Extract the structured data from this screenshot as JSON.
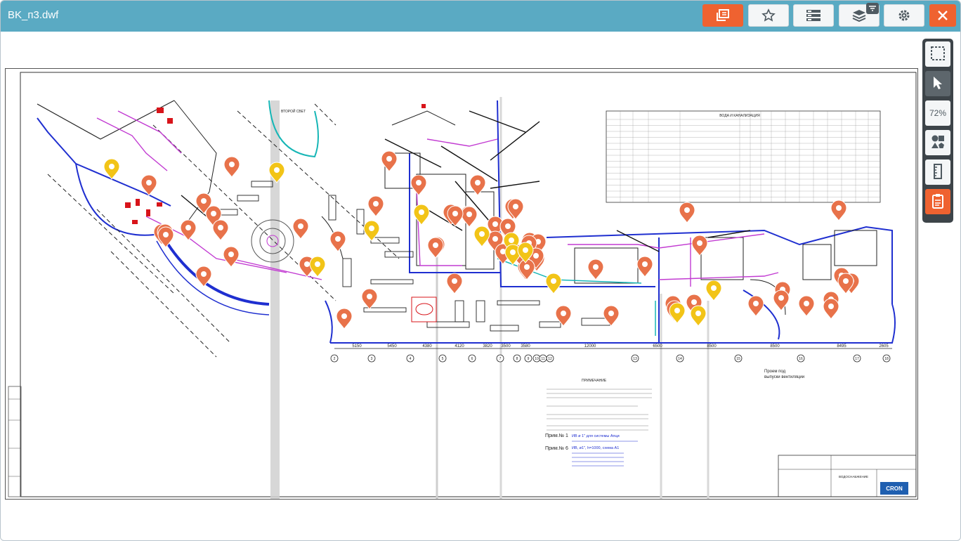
{
  "window": {
    "title": "BK_п3.dwf"
  },
  "toolbar": {
    "buttons": [
      {
        "name": "markup-panel-button",
        "icon": "copy-icon"
      },
      {
        "name": "favorite-button",
        "icon": "star-icon"
      },
      {
        "name": "properties-button",
        "icon": "list-icon"
      },
      {
        "name": "layers-button",
        "icon": "layers-icon"
      },
      {
        "name": "settings-button",
        "icon": "gear-icon"
      },
      {
        "name": "close-button",
        "icon": "close-icon"
      }
    ]
  },
  "side_toolbar": {
    "zoom_label": "72%",
    "tools": [
      "select-area-icon",
      "pointer-icon",
      "zoom",
      "shapes-icon",
      "ruler-icon",
      "clipboard-icon"
    ]
  },
  "drawing": {
    "table_title": "ВОДА И КАНАЛИЗАЦИЯ",
    "notes_title": "ПРИМЕЧАНИЕ",
    "note1_label": "Прим.№ 1",
    "note1_text": "ИВ ø 1\" для системы Апци",
    "note2_label": "Прим.№ 6",
    "note2_text": "ИВ, ø1\", h=1000, схема A1",
    "stamp_title": "ВОДОСНАБЖЕНИЕ",
    "logo_text": "CRON",
    "second_light": "ВТОРОЙ СВЕТ",
    "dims": [
      "5150",
      "5450",
      "4380",
      "4120",
      "3820",
      "3500",
      "3580",
      "12000",
      "6500",
      "8500",
      "8500",
      "8495",
      "2605"
    ],
    "axis_labels": [
      "2",
      "3",
      "4",
      "5",
      "6",
      "7",
      "8",
      "9",
      "10",
      "11",
      "12",
      "13",
      "14",
      "15",
      "16",
      "17",
      "18"
    ],
    "section_label_left": "Проем под",
    "section_label_left2": "выпуски вентиляции"
  },
  "markers": {
    "orange_color": "#e8724a",
    "yellow_color": "#f2c417",
    "orange_count": 66,
    "yellow_count": 13
  }
}
